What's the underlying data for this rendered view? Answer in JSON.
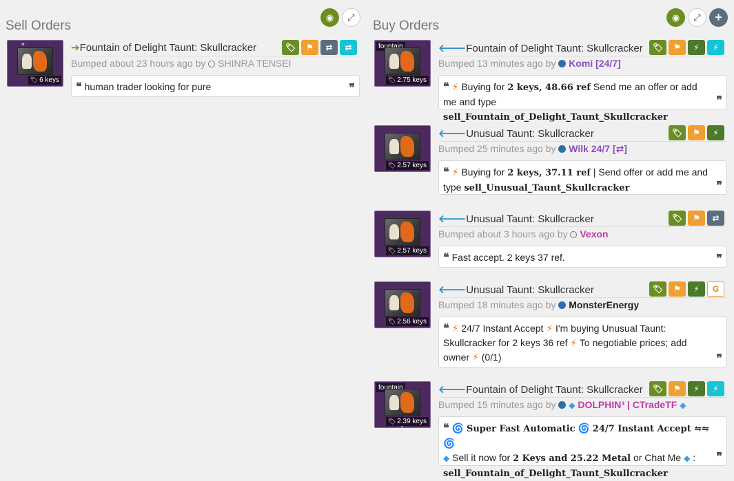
{
  "sell": {
    "title": "Sell Orders",
    "listings": [
      {
        "price": "6 keys",
        "item": "Fountain of Delight Taunt: Skullcracker",
        "bumped": "Bumped about 23 hours ago by",
        "user": "SHINRA TENSEI",
        "comment": "human trader looking for pure"
      }
    ]
  },
  "buy": {
    "title": "Buy Orders",
    "listings": [
      {
        "effect_tag": "fountain",
        "price": "2.75 keys",
        "item": "Fountain of Delight Taunt: Skullcracker",
        "bumped": "Bumped 13 minutes ago by",
        "user": "Komi [24/7]",
        "comment_pre": "Buying for ",
        "comment_price": "2 keys, 48.66 ref",
        "comment_mid": " Send me an offer or add me and type ",
        "comment_cmd": "sell_Fountain_of_Delight_Taunt_Skullcracker"
      },
      {
        "price": "2.57 keys",
        "item": "Unusual Taunt: Skullcracker",
        "bumped": "Bumped 25 minutes ago by",
        "user": "Wilk 24/7 [⇄]",
        "comment_pre": "Buying for ",
        "comment_price": "2 keys, 37.11 ref",
        "comment_mid": " | Send offer or add me and type ",
        "comment_cmd": "sell_Unusual_Taunt_Skullcracker"
      },
      {
        "price": "2.57 keys",
        "item": "Unusual Taunt: Skullcracker",
        "bumped": "Bumped about 3 hours ago by",
        "user": "Vexon",
        "comment": "Fast accept. 2 keys 37 ref."
      },
      {
        "price": "2.56 keys",
        "item": "Unusual Taunt: Skullcracker",
        "bumped": "Bumped 18 minutes ago by",
        "user": "MonsterEnergy",
        "comment_a": " 24/7 Instant Accept ",
        "comment_b": " I'm buying Unusual Taunt: Skullcracker for 2 keys 36 ref ",
        "comment_c": " To negotiable prices; add owner ",
        "comment_d": " (0/1)"
      },
      {
        "effect_tag": "fountain",
        "price": "2.39 keys",
        "item": "Fountain of Delight Taunt: Skullcracker",
        "bumped": "Bumped 15 minutes ago by",
        "user": "DOLPHIN³ | CTradeTF",
        "comment_a": "Super Fast Automatic",
        "comment_b": "24/7 Instant Accept ⇋⇋",
        "comment_c": " Sell it now for ",
        "comment_price": "2 Keys and 25.22 Metal",
        "comment_d": " or Chat Me ",
        "comment_e": " : ",
        "comment_cmd": "sell_Fountain_of_Delight_Taunt_Skullcracker"
      }
    ]
  },
  "icons": {
    "arrow_right": "➔",
    "arrow_left": "🡐",
    "quote_open": "❝",
    "quote_close": "❞",
    "bolt": "⚡",
    "spiral": "🌀",
    "diamond": "◆"
  }
}
